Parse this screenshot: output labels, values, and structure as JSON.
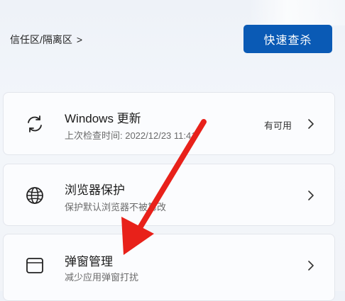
{
  "breadcrumb": {
    "label": "信任区/隔离区"
  },
  "quick_scan": {
    "label": "快速查杀"
  },
  "cards": [
    {
      "title": "Windows 更新",
      "subtitle": "上次检查时间: 2022/12/23 11:41",
      "status": "有可用",
      "icon": "refresh-icon"
    },
    {
      "title": "浏览器保护",
      "subtitle": "保护默认浏览器不被篡改",
      "icon": "globe-icon"
    },
    {
      "title": "弹窗管理",
      "subtitle": "减少应用弹窗打扰",
      "icon": "window-icon"
    }
  ],
  "annotation": {
    "arrow_color": "#e8211a"
  }
}
